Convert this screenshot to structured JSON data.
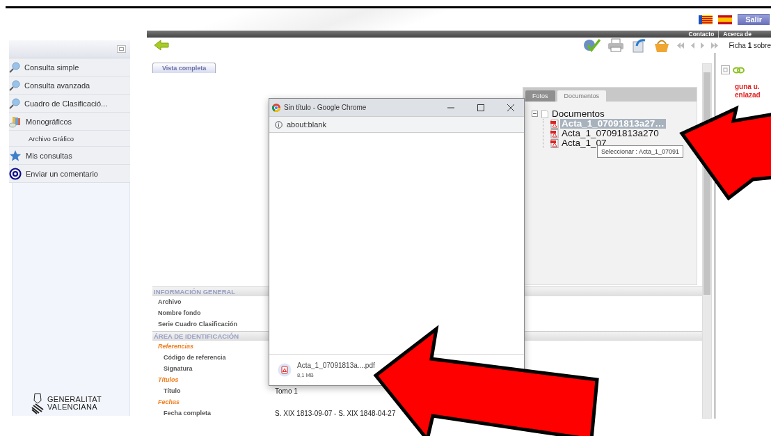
{
  "header": {
    "logout_button": "Salir",
    "links": [
      "Contacto",
      "Acerca de"
    ]
  },
  "sidebar": {
    "items": [
      {
        "label": "Consulta simple",
        "kind": "search"
      },
      {
        "label": "Consulta avanzada",
        "kind": "search"
      },
      {
        "label": "Cuadro de Clasificació...",
        "kind": "search"
      },
      {
        "label": "Monográficos",
        "kind": "books"
      },
      {
        "label": "Archivo Gráfico",
        "kind": "sub"
      },
      {
        "label": "Mis consultas",
        "kind": "star"
      },
      {
        "label": "Enviar un comentario",
        "kind": "mail"
      }
    ],
    "logo_lines": [
      "GENERALITAT",
      "VALENCIANA"
    ]
  },
  "toolbar": {
    "pager": "Ficha **1** sobre"
  },
  "view_tabs": [
    {
      "label": "Vista completa",
      "selected": true
    }
  ],
  "documents_panel": {
    "tabs": [
      {
        "label": "Fotos",
        "selected": false
      },
      {
        "label": "Documentos",
        "selected": true
      }
    ],
    "tree": {
      "label": "Documentos",
      "expanded": true,
      "children": [
        {
          "label": "Acta_1_07091813a27…",
          "selected": true
        },
        {
          "label": "Acta_1_07091813a270",
          "selected": false
        },
        {
          "label": "Acta_1_07",
          "selected": false
        }
      ]
    },
    "tooltip": "Seleccionar : Acta_1_07091"
  },
  "side_panel": {
    "message_lines": [
      "guna u.",
      "enlazad"
    ]
  },
  "info_sections": [
    {
      "title": "INFORMACIÓN GENERAL",
      "rows": [
        {
          "kind": "field",
          "label": "Archivo"
        },
        {
          "kind": "field",
          "label": "Nombre fondo"
        },
        {
          "kind": "field",
          "label": "Serie Cuadro Clasificación"
        }
      ]
    },
    {
      "title": "ÁREA DE IDENTIFICACIÓN",
      "rows": [
        {
          "kind": "subhead",
          "label": "Referencias"
        },
        {
          "kind": "subfield",
          "label": "Código de referencia"
        },
        {
          "kind": "subfield",
          "label": "Signatura"
        },
        {
          "kind": "subhead",
          "label": "Títulos"
        },
        {
          "kind": "subfield",
          "label": "Título",
          "value": "Tomo 1"
        },
        {
          "kind": "subhead",
          "label": "Fechas"
        },
        {
          "kind": "subfield",
          "label": "Fecha completa",
          "value": "S. XIX 1813-09-07 - S. XIX 1848-04-27"
        }
      ]
    }
  ],
  "popup": {
    "title": "Sin título - Google Chrome",
    "url": "about:blank",
    "download": {
      "filename": "Acta_1_07091813a....pdf",
      "size": "8,1 MB"
    }
  }
}
